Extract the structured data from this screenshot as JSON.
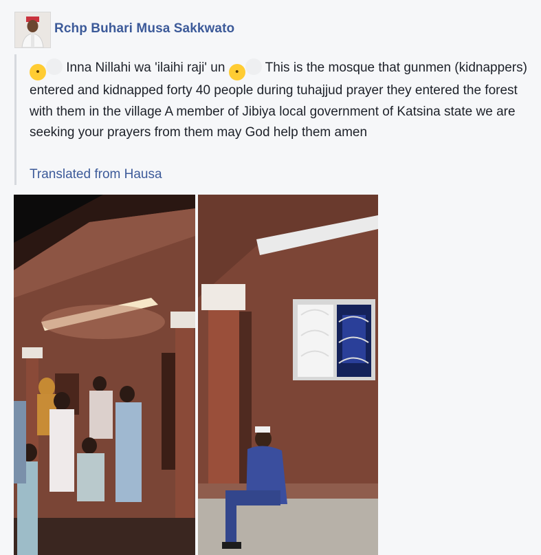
{
  "post": {
    "author": "Rchp Buhari Musa Sakkwato",
    "text_part1": "Inna Nillahi wa 'ilaihi raji' un",
    "text_part2": "This is the mosque that gunmen (kidnappers) entered and kidnapped forty 40 people during tuhajjud prayer they entered the forest with them in the village A member of Jibiya local government of Katsina state we are seeking your prayers from them may God help them amen",
    "translated_label": "Translated from Hausa",
    "emoji_1": "crying-face-icon",
    "emoji_2": "weary-face-icon"
  },
  "colors": {
    "link_blue": "#3c5a99",
    "text": "#1d2129",
    "background": "#f6f7f9"
  }
}
